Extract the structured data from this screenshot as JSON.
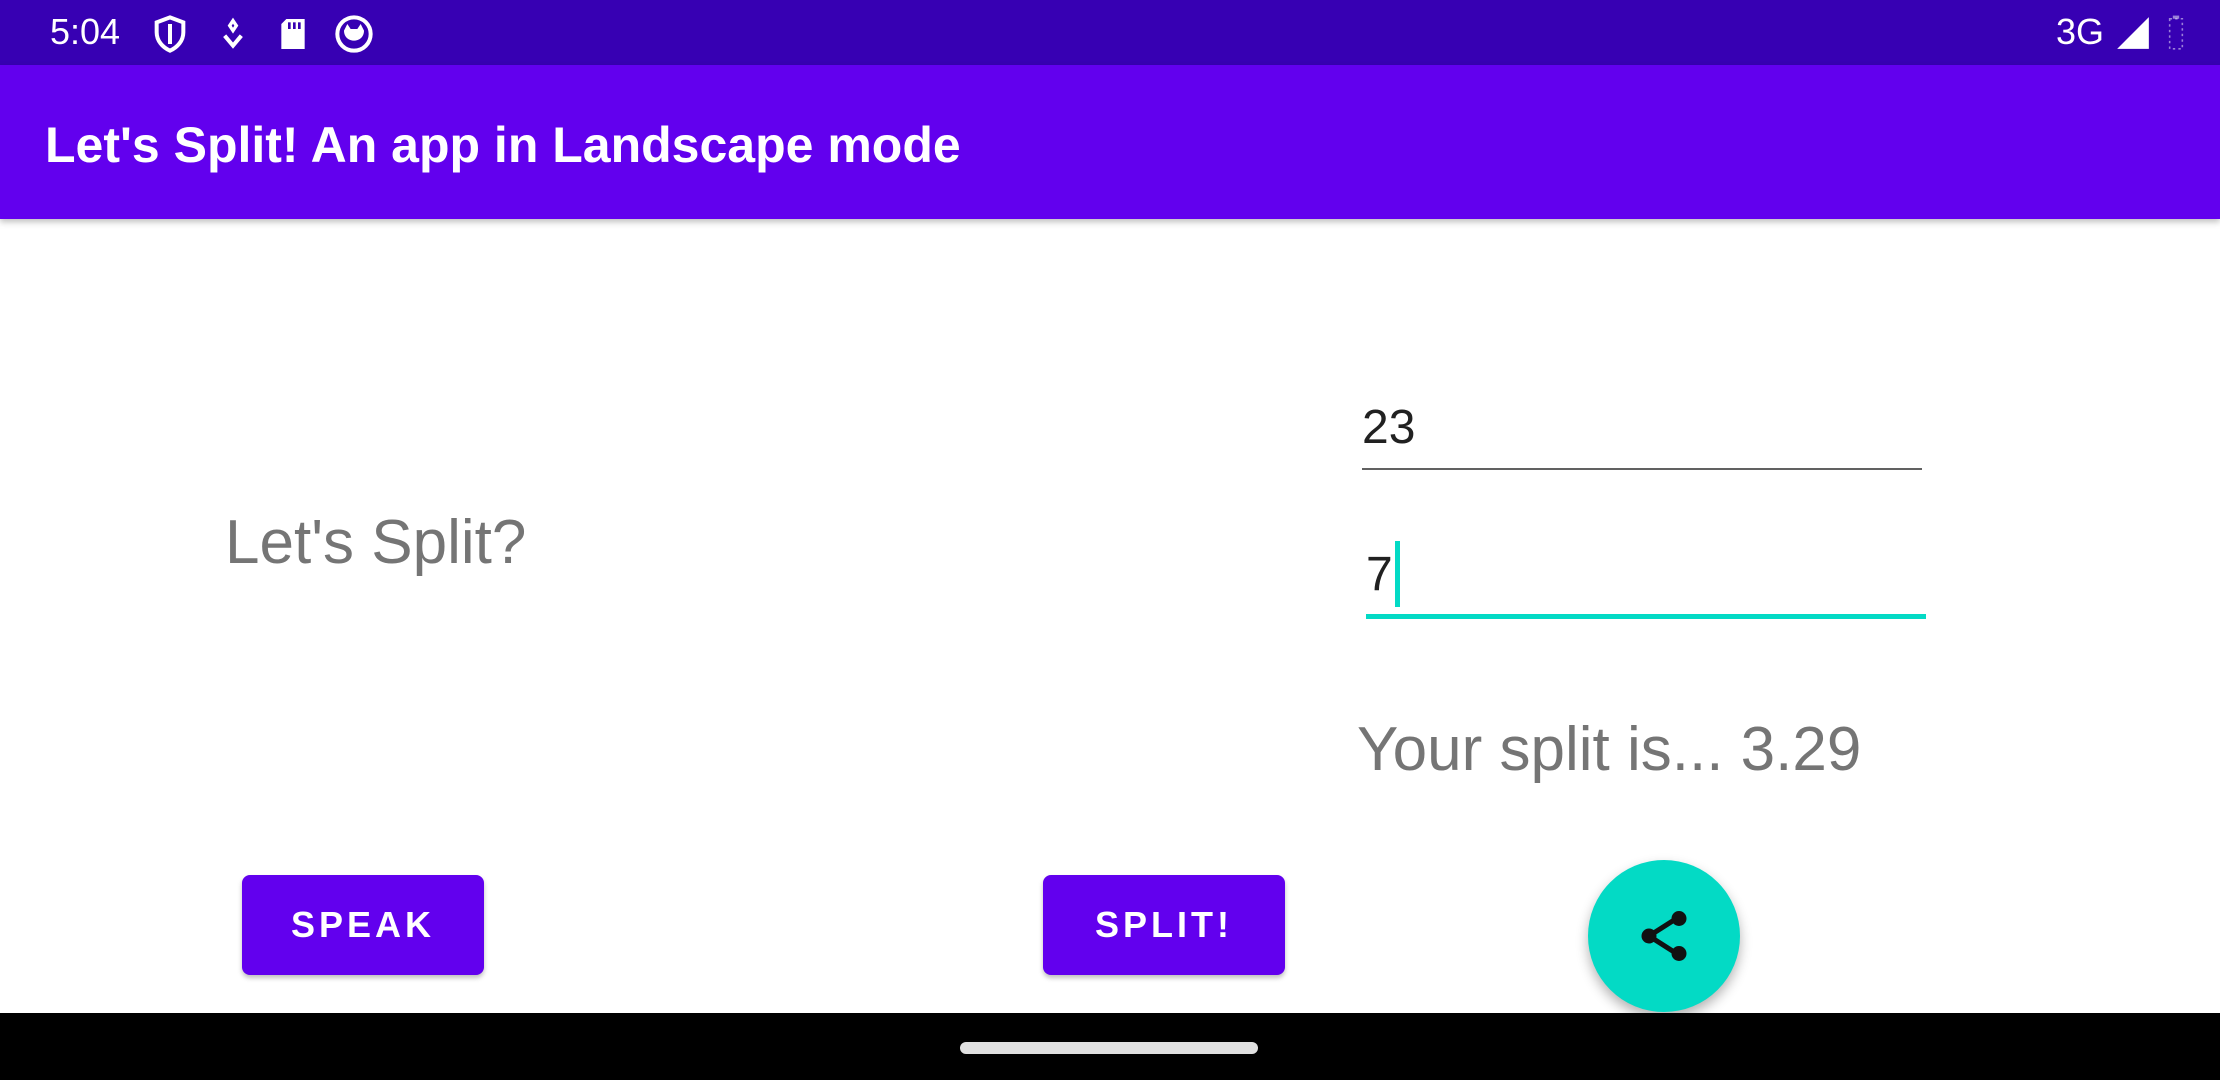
{
  "status_bar": {
    "time": "5:04",
    "network": "3G",
    "icons": [
      "vpn-shield-icon",
      "location-pin-icon",
      "sd-card-icon",
      "cat-face-icon",
      "signal-icon",
      "battery-icon"
    ]
  },
  "app_bar": {
    "title": "Let's Split! An app in Landscape mode"
  },
  "main": {
    "prompt": "Let's Split?",
    "amount_field": {
      "value": "23"
    },
    "people_field": {
      "value": "7"
    },
    "result": "Your split is... 3.29"
  },
  "actions": {
    "speak_label": "SPEAK",
    "split_label": "SPLIT!",
    "fab_icon": "share-icon"
  },
  "colors": {
    "primary": "#6200ee",
    "primary_dark": "#3700b3",
    "accent": "#03dac5"
  }
}
